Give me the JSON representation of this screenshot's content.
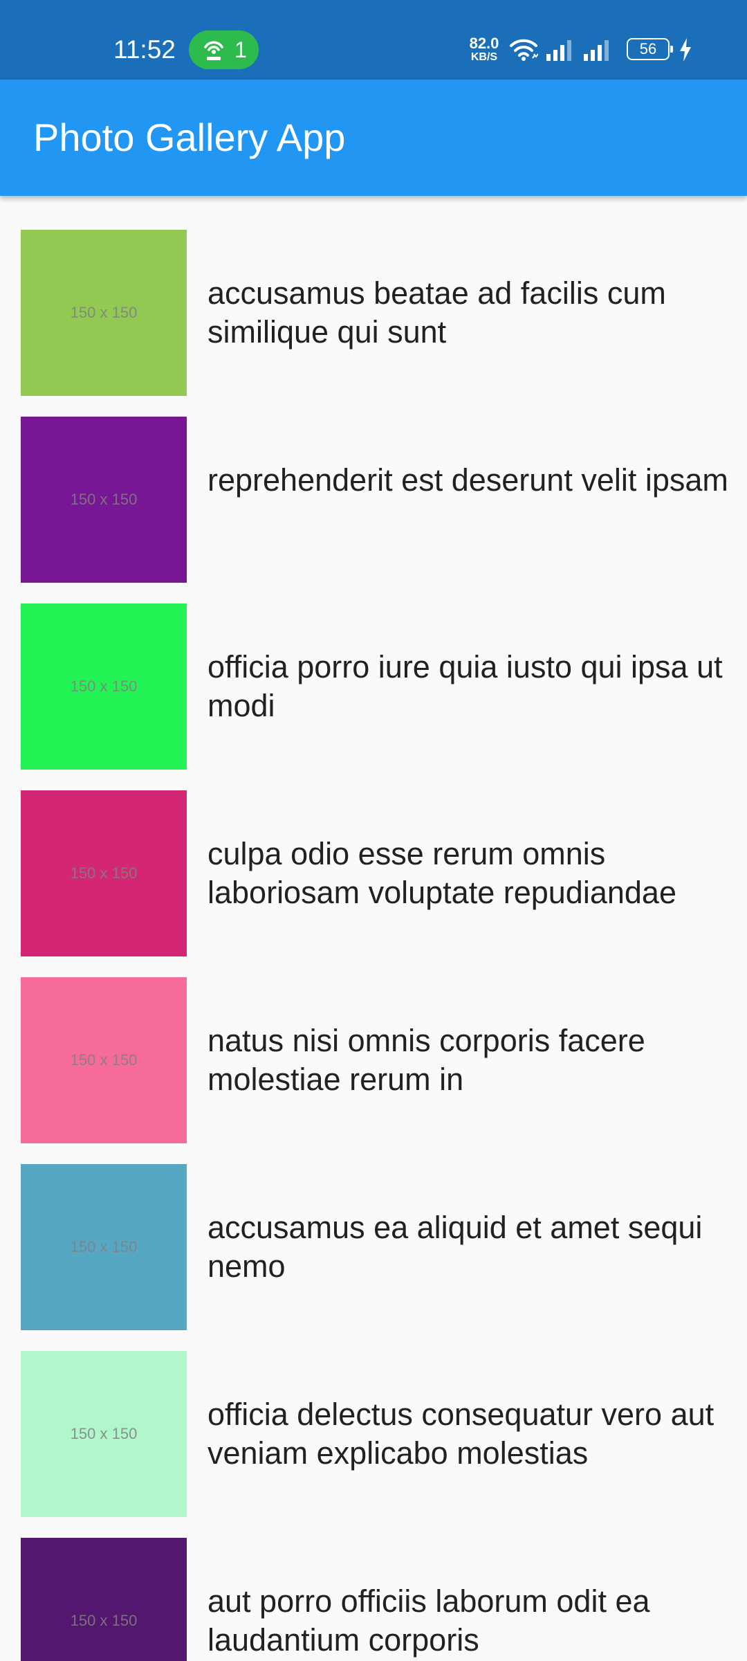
{
  "status_bar": {
    "time": "11:52",
    "hotspot_count": "1",
    "net_speed_value": "82.0",
    "net_speed_unit": "KB/S",
    "battery_level": "56",
    "icons": [
      "hotspot-icon",
      "wifi-icon",
      "signal-icon",
      "signal-icon",
      "battery-icon",
      "charging-icon"
    ]
  },
  "app_bar": {
    "title": "Photo Gallery App",
    "color": "#2196f3"
  },
  "photos": [
    {
      "title": "accusamus beatae ad facilis cum similique qui sunt",
      "thumb_label": "150 x 150",
      "color": "#92c952"
    },
    {
      "title": "reprehenderit est deserunt velit ipsam",
      "thumb_label": "150 x 150",
      "color": "#771796"
    },
    {
      "title": "officia porro iure quia iusto qui ipsa ut modi",
      "thumb_label": "150 x 150",
      "color": "#24f355"
    },
    {
      "title": "culpa odio esse rerum omnis laboriosam voluptate repudiandae",
      "thumb_label": "150 x 150",
      "color": "#d32776"
    },
    {
      "title": "natus nisi omnis corporis facere molestiae rerum in",
      "thumb_label": "150 x 150",
      "color": "#f66b97"
    },
    {
      "title": "accusamus ea aliquid et amet sequi nemo",
      "thumb_label": "150 x 150",
      "color": "#56a8c2"
    },
    {
      "title": "officia delectus consequatur vero aut veniam explicabo molestias",
      "thumb_label": "150 x 150",
      "color": "#b0f7cc"
    },
    {
      "title": "aut porro officiis laborum odit ea laudantium corporis",
      "thumb_label": "150 x 150",
      "color": "#54176f"
    }
  ]
}
